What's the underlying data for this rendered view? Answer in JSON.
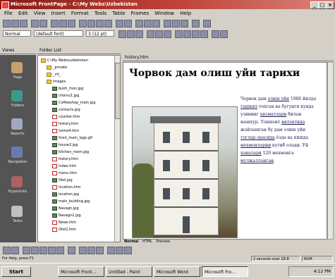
{
  "window": {
    "title": "Microsoft FrontPage - C:\\My Webs\\Uzbekistan",
    "min": "_",
    "max": "□",
    "close": "×"
  },
  "menu": [
    "File",
    "Edit",
    "View",
    "Insert",
    "Format",
    "Tools",
    "Table",
    "Frames",
    "Window",
    "Help"
  ],
  "toolbar": {
    "style": "Normal",
    "font": "(default font)",
    "size": "3 (12 pt)"
  },
  "panels": {
    "views_header": "Views",
    "folders_header": "Folder List",
    "page_header": "history.htm"
  },
  "views": [
    "Page",
    "Folders",
    "Reports",
    "Navigation",
    "Hyperlinks",
    "Tasks"
  ],
  "folders": [
    {
      "name": "C:\\My Webs\\uzbekistan",
      "kind": "folder",
      "indent": 0
    },
    {
      "name": "_private",
      "kind": "folder",
      "indent": 1
    },
    {
      "name": "_vti_",
      "kind": "folder",
      "indent": 1
    },
    {
      "name": "images",
      "kind": "folder",
      "indent": 1
    },
    {
      "name": "bukh_mon.jpg",
      "kind": "img",
      "indent": 2
    },
    {
      "name": "chorsu1.jpg",
      "kind": "img",
      "indent": 2
    },
    {
      "name": "Coffeeshop_main.jpg",
      "kind": "img",
      "indent": 2
    },
    {
      "name": "contacts.jpg",
      "kind": "img",
      "indent": 2
    },
    {
      "name": "counter.htm",
      "kind": "html",
      "indent": 2
    },
    {
      "name": "history.htm",
      "kind": "html",
      "indent": 2
    },
    {
      "name": "home4.htm",
      "kind": "html",
      "indent": 2
    },
    {
      "name": "front_main_logo.gif",
      "kind": "img",
      "indent": 2
    },
    {
      "name": "house2.jpg",
      "kind": "img",
      "indent": 2
    },
    {
      "name": "kitchen_room.jpg",
      "kind": "img",
      "indent": 2
    },
    {
      "name": "history.htm",
      "kind": "html",
      "indent": 2
    },
    {
      "name": "index.htm",
      "kind": "html",
      "indent": 2
    },
    {
      "name": "menu.htm",
      "kind": "html",
      "indent": 2
    },
    {
      "name": "Otel.jpg",
      "kind": "img",
      "indent": 2
    },
    {
      "name": "location.htm",
      "kind": "html",
      "indent": 2
    },
    {
      "name": "location.jpg",
      "kind": "img",
      "indent": 2
    },
    {
      "name": "main_building.jpg",
      "kind": "img",
      "indent": 2
    },
    {
      "name": "Navagn.jpg",
      "kind": "img",
      "indent": 2
    },
    {
      "name": "Navagn2.jpg",
      "kind": "img",
      "indent": 2
    },
    {
      "name": "News.htm",
      "kind": "html",
      "indent": 2
    },
    {
      "name": "Otel1.htm",
      "kind": "html",
      "indent": 2
    }
  ],
  "document": {
    "heading": "Чорвок дам олиш уйи тарихи",
    "paragraph": [
      {
        "t": "Чорвок дам ",
        "u": false
      },
      {
        "t": "олиш уйи",
        "u": true
      },
      {
        "t": " 1986 йилда ",
        "u": false
      },
      {
        "t": "ташкил",
        "u": true
      },
      {
        "t": " топган ва бугунги кунда узининг ",
        "u": false
      },
      {
        "t": "хизматлари",
        "u": true
      },
      {
        "t": " билан машхур. Тошкент ",
        "u": false
      },
      {
        "t": "вилоятида",
        "u": true
      },
      {
        "t": " жойлашган бу дам олиш уйи ",
        "u": false
      },
      {
        "t": "тоглар орасида",
        "u": true
      },
      {
        "t": " ёзда ва кишда ",
        "u": false
      },
      {
        "t": "мехмонларни",
        "u": true
      },
      {
        "t": " кутиб олади. Уй ",
        "u": false
      },
      {
        "t": "хоналари",
        "u": true
      },
      {
        "t": " 120 мехмонга ",
        "u": false
      },
      {
        "t": "мулжалланган",
        "u": true
      },
      {
        "t": ".",
        "u": false
      }
    ]
  },
  "tabs": {
    "normal": "Normal",
    "html": "HTML",
    "preview": "Preview"
  },
  "status": {
    "left": "For Help, press F1",
    "right": "2 seconds over 28.8",
    "mode": "NUM"
  },
  "taskbar": {
    "start": "Start",
    "tasks": [
      "Microsoft Front...",
      "Untitled - Paint",
      "Microsoft Word",
      "Microsoft Fro..."
    ],
    "active_index": 3,
    "clock": "4:12 PM"
  },
  "colors": {
    "title_gradient_start": "#8a1c14",
    "views_bg": "#545454",
    "link_text": "#1a1a5a"
  }
}
